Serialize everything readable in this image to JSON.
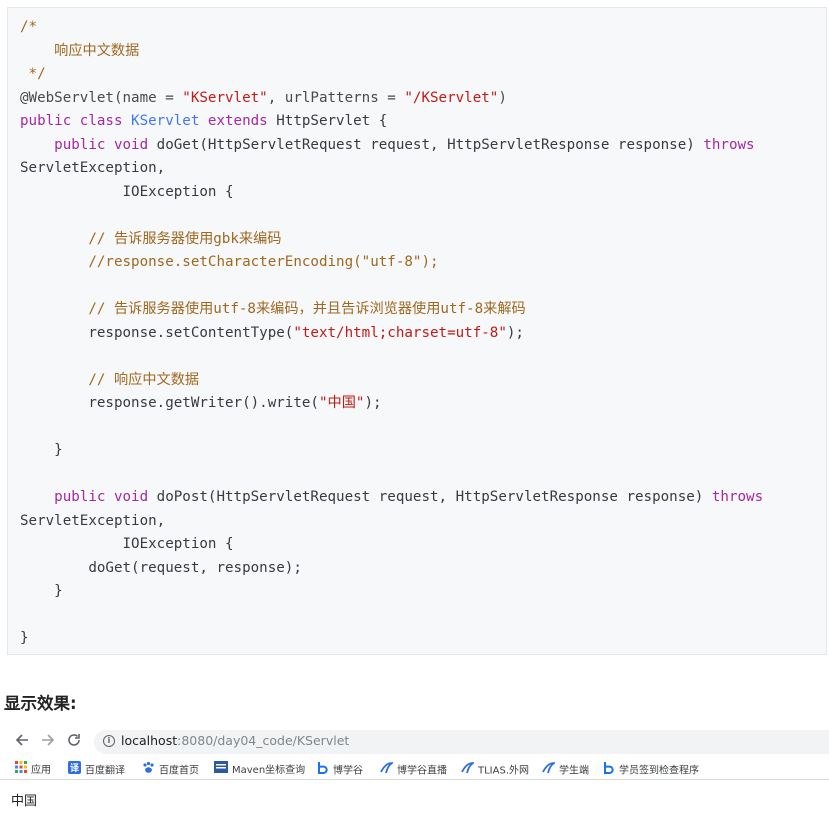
{
  "code_lines": [
    [
      {
        "t": "/*",
        "c": "cmt"
      }
    ],
    [
      {
        "t": "    响应中文数据",
        "c": "cmt"
      }
    ],
    [
      {
        "t": " */",
        "c": "cmt"
      }
    ],
    [
      {
        "t": "@WebServlet(name = ",
        "c": "ann"
      },
      {
        "t": "\"KServlet\"",
        "c": "str"
      },
      {
        "t": ", urlPatterns = ",
        "c": "ann"
      },
      {
        "t": "\"/KServlet\"",
        "c": "str"
      },
      {
        "t": ")",
        "c": "ann"
      }
    ],
    [
      {
        "t": "public class ",
        "c": "kw"
      },
      {
        "t": "KServlet ",
        "c": "cls"
      },
      {
        "t": "extends ",
        "c": "kw"
      },
      {
        "t": "HttpServlet {",
        "c": ""
      }
    ],
    [
      {
        "t": "    public void ",
        "c": "kw"
      },
      {
        "t": "doGet(HttpServletRequest request, HttpServletResponse response) ",
        "c": ""
      },
      {
        "t": "throws",
        "c": "kw"
      }
    ],
    [
      {
        "t": "ServletException,",
        "c": ""
      }
    ],
    [
      {
        "t": "            IOException {",
        "c": ""
      }
    ],
    [
      {
        "t": "",
        "c": ""
      }
    ],
    [
      {
        "t": "        // 告诉服务器使用gbk来编码",
        "c": "cmt"
      }
    ],
    [
      {
        "t": "        //response.setCharacterEncoding(\"utf-8\");",
        "c": "cmt"
      }
    ],
    [
      {
        "t": "",
        "c": ""
      }
    ],
    [
      {
        "t": "        // 告诉服务器使用utf-8来编码，并且告诉浏览器使用utf-8来解码",
        "c": "cmt"
      }
    ],
    [
      {
        "t": "        response.setContentType(",
        "c": ""
      },
      {
        "t": "\"text/html;charset=utf-8\"",
        "c": "str"
      },
      {
        "t": ");",
        "c": ""
      }
    ],
    [
      {
        "t": "",
        "c": ""
      }
    ],
    [
      {
        "t": "        // 响应中文数据",
        "c": "cmt"
      }
    ],
    [
      {
        "t": "        response.getWriter().write(",
        "c": ""
      },
      {
        "t": "\"中国\"",
        "c": "str"
      },
      {
        "t": ");",
        "c": ""
      }
    ],
    [
      {
        "t": "",
        "c": ""
      }
    ],
    [
      {
        "t": "    }",
        "c": ""
      }
    ],
    [
      {
        "t": "",
        "c": ""
      }
    ],
    [
      {
        "t": "    public void ",
        "c": "kw"
      },
      {
        "t": "doPost(HttpServletRequest request, HttpServletResponse response) ",
        "c": ""
      },
      {
        "t": "throws",
        "c": "kw"
      }
    ],
    [
      {
        "t": "ServletException,",
        "c": ""
      }
    ],
    [
      {
        "t": "            IOException {",
        "c": ""
      }
    ],
    [
      {
        "t": "        doGet(request, response);",
        "c": ""
      }
    ],
    [
      {
        "t": "    }",
        "c": ""
      }
    ],
    [
      {
        "t": "",
        "c": ""
      }
    ],
    [
      {
        "t": "}",
        "c": ""
      }
    ]
  ],
  "section_title": "显示效果:",
  "browser": {
    "back_icon": "arrow-left-icon",
    "forward_icon": "arrow-right-icon",
    "reload_icon": "reload-icon",
    "url_host": "localhost",
    "url_path": ":8080/day04_code/KServlet",
    "bookmarks": [
      {
        "icon": "apps-grid-icon",
        "label": "应用"
      },
      {
        "icon": "baidu-translate-icon",
        "label": "百度翻译"
      },
      {
        "icon": "baidu-paw-icon",
        "label": "百度首页"
      },
      {
        "icon": "maven-icon",
        "label": "Maven坐标查询"
      },
      {
        "icon": "bo-icon",
        "label": "博学谷"
      },
      {
        "icon": "tlias-icon",
        "label": "博学谷直播"
      },
      {
        "icon": "tlias-icon",
        "label": "TLIAS.外网"
      },
      {
        "icon": "tlias-icon",
        "label": "学生端"
      },
      {
        "icon": "bo-icon",
        "label": "学员签到检查程序"
      }
    ],
    "page_text": "中国"
  },
  "colors": {
    "code_bg": "#f6f8fa",
    "comment": "#a0681f",
    "keyword": "#a626a4",
    "string": "#c41a16",
    "class_name": "#4078f2"
  }
}
